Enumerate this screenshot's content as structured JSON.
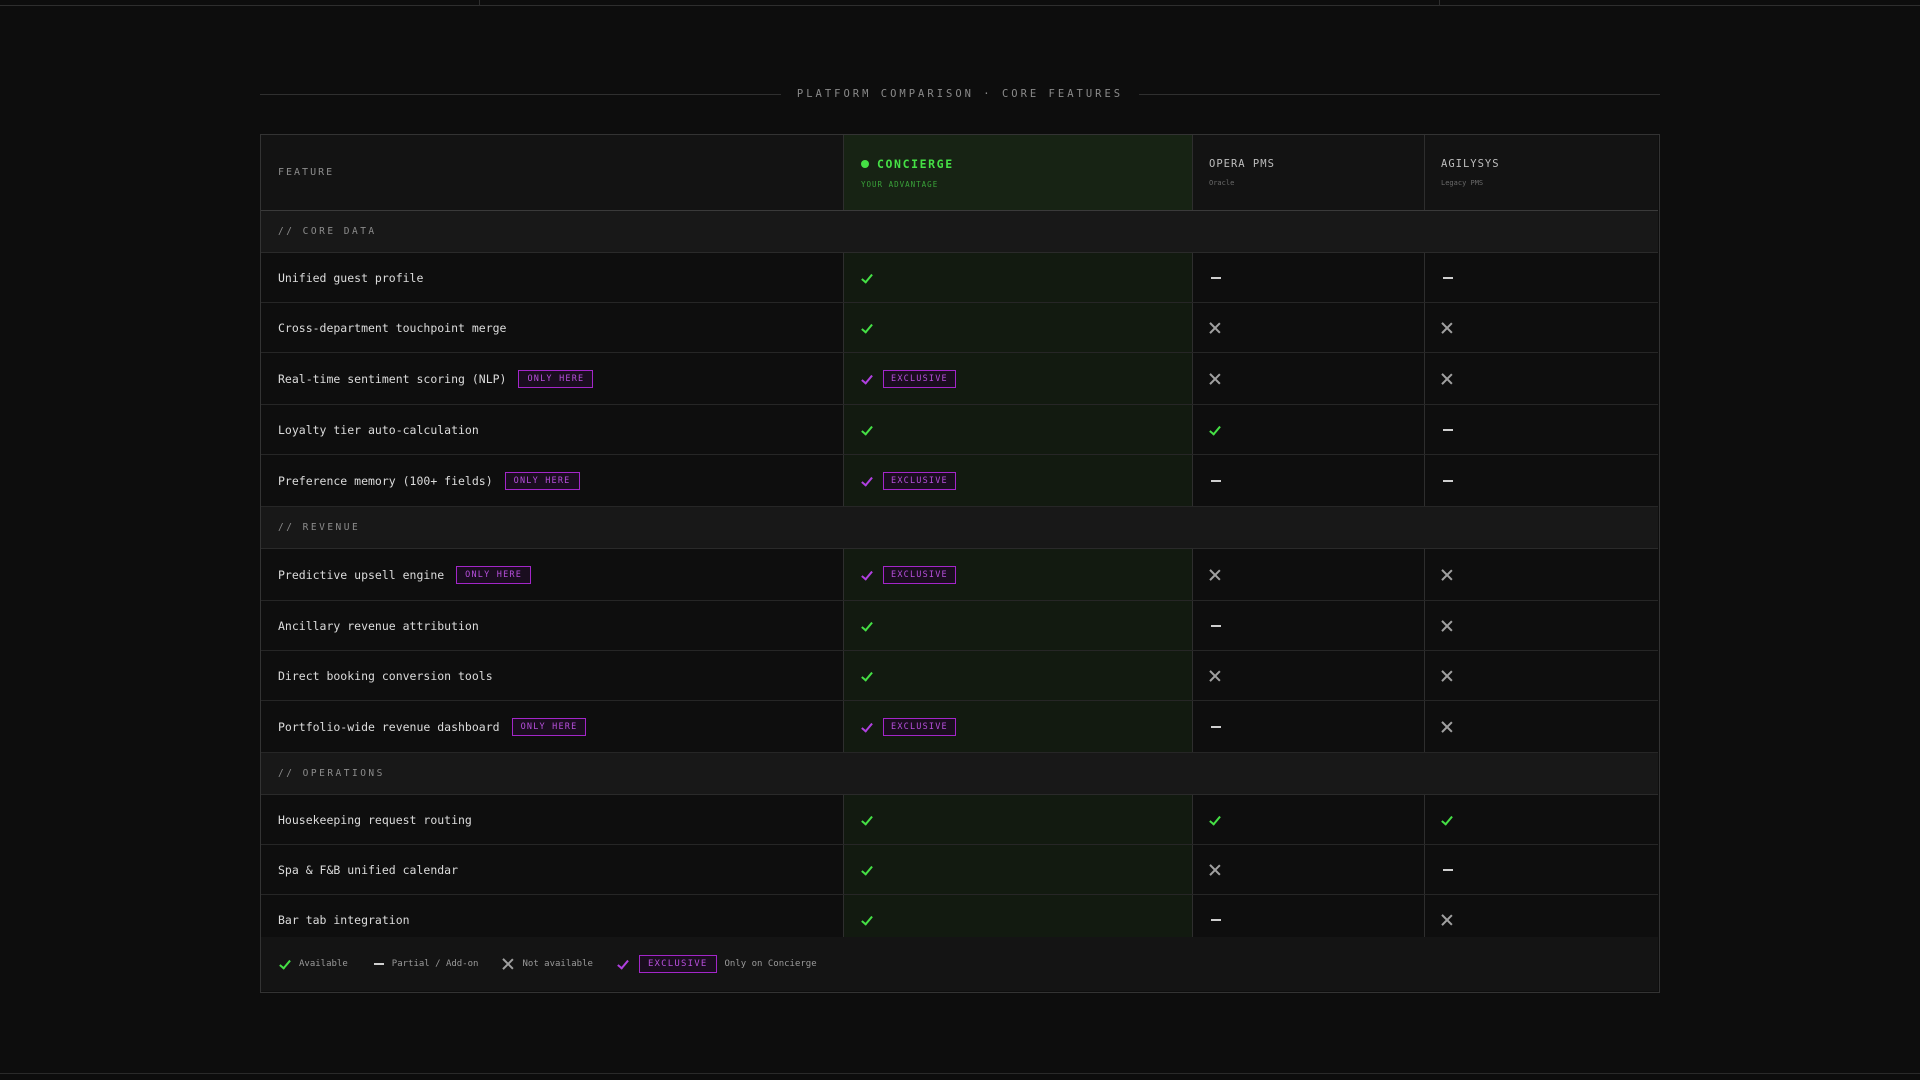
{
  "heading": "PLATFORM COMPARISON · CORE FEATURES",
  "colors": {
    "accent_green": "#45e045",
    "accent_purple": "#b040e0",
    "background": "#0d0d0d"
  },
  "columns": {
    "feature": "FEATURE",
    "concierge": {
      "name": "CONCIERGE",
      "sub": "YOUR ADVANTAGE"
    },
    "opera": {
      "name": "OPERA PMS",
      "sub": "Oracle"
    },
    "agilysys": {
      "name": "AGILYSYS",
      "sub": "Legacy PMS"
    }
  },
  "badges": {
    "only_here": "ONLY HERE",
    "exclusive": "EXCLUSIVE"
  },
  "sections": [
    {
      "title": "// CORE DATA",
      "rows": [
        {
          "feature": "Unified guest profile",
          "only_here": false,
          "concierge": "check",
          "opera": "dash",
          "agilysys": "dash"
        },
        {
          "feature": "Cross-department touchpoint merge",
          "only_here": false,
          "concierge": "check",
          "opera": "cross",
          "agilysys": "cross"
        },
        {
          "feature": "Real-time sentiment scoring (NLP)",
          "only_here": true,
          "concierge": "exclusive",
          "opera": "cross",
          "agilysys": "cross"
        },
        {
          "feature": "Loyalty tier auto-calculation",
          "only_here": false,
          "concierge": "check",
          "opera": "check",
          "agilysys": "dash"
        },
        {
          "feature": "Preference memory (100+ fields)",
          "only_here": true,
          "concierge": "exclusive",
          "opera": "dash",
          "agilysys": "dash"
        }
      ]
    },
    {
      "title": "// REVENUE",
      "rows": [
        {
          "feature": "Predictive upsell engine",
          "only_here": true,
          "concierge": "exclusive",
          "opera": "cross",
          "agilysys": "cross"
        },
        {
          "feature": "Ancillary revenue attribution",
          "only_here": false,
          "concierge": "check",
          "opera": "dash",
          "agilysys": "cross"
        },
        {
          "feature": "Direct booking conversion tools",
          "only_here": false,
          "concierge": "check",
          "opera": "cross",
          "agilysys": "cross"
        },
        {
          "feature": "Portfolio-wide revenue dashboard",
          "only_here": true,
          "concierge": "exclusive",
          "opera": "dash",
          "agilysys": "cross"
        }
      ]
    },
    {
      "title": "// OPERATIONS",
      "rows": [
        {
          "feature": "Housekeeping request routing",
          "only_here": false,
          "concierge": "check",
          "opera": "check",
          "agilysys": "check"
        },
        {
          "feature": "Spa & F&B unified calendar",
          "only_here": false,
          "concierge": "check",
          "opera": "cross",
          "agilysys": "dash"
        },
        {
          "feature": "Bar tab integration",
          "only_here": false,
          "concierge": "check",
          "opera": "dash",
          "agilysys": "cross"
        }
      ]
    }
  ],
  "legend": {
    "available": "Available",
    "partial": "Partial / Add-on",
    "not_available": "Not available",
    "exclusive_badge": "EXCLUSIVE",
    "exclusive_text": "Only on Concierge"
  }
}
